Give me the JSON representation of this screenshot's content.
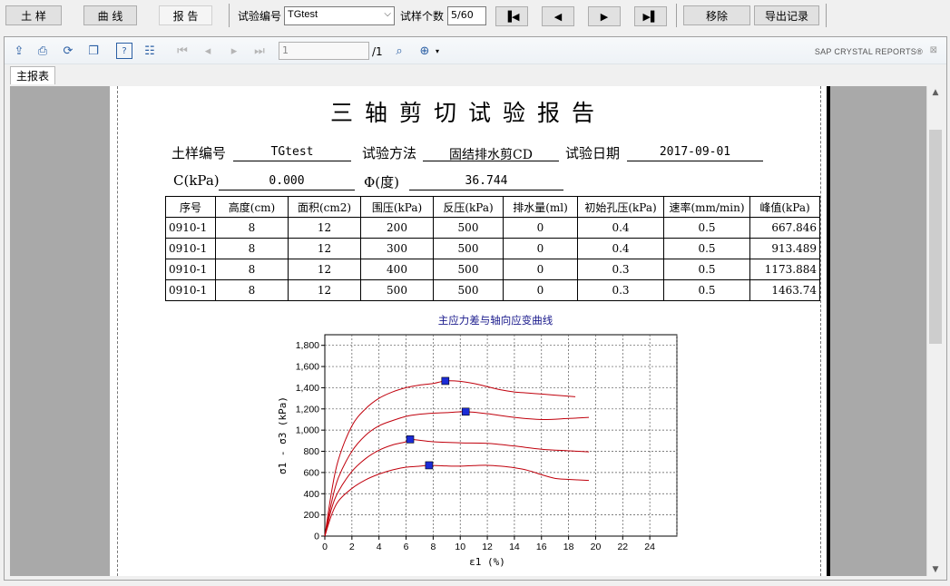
{
  "topbar": {
    "btn_soil": "土 样",
    "btn_curve": "曲 线",
    "btn_report": "报 告",
    "test_no_label": "试验编号",
    "test_no_value": "TGtest",
    "sample_count_label": "试样个数",
    "sample_count_value": "5/60",
    "nav_first": "▐◀",
    "nav_prev": "◀",
    "nav_next": "▶",
    "nav_last": "▶▌",
    "btn_remove": "移除",
    "btn_export": "导出记录"
  },
  "viewer": {
    "page_value": "1",
    "page_total": "/1",
    "brand": "SAP CRYSTAL REPORTS®",
    "tab_main": "主报表"
  },
  "report": {
    "title": "三轴剪切试验报告",
    "soil_no_label": "土样编号",
    "soil_no_value": "TGtest",
    "method_label": "试验方法",
    "method_value": "固结排水剪CD",
    "date_label": "试验日期",
    "date_value": "2017-09-01",
    "c_label": "C(kPa)",
    "c_value": "0.000",
    "phi_label": "Φ(度)",
    "phi_value": "36.744",
    "table_headers": [
      "序号",
      "高度(cm)",
      "面积(cm2)",
      "围压(kPa)",
      "反压(kPa)",
      "排水量(ml)",
      "初始孔压(kPa)",
      "速率(mm/min)",
      "峰值(kPa)"
    ],
    "table_rows": [
      [
        "0910-1",
        "8",
        "12",
        "200",
        "500",
        "0",
        "0.4",
        "0.5",
        "667.846"
      ],
      [
        "0910-1",
        "8",
        "12",
        "300",
        "500",
        "0",
        "0.4",
        "0.5",
        "913.489"
      ],
      [
        "0910-1",
        "8",
        "12",
        "400",
        "500",
        "0",
        "0.3",
        "0.5",
        "1173.884"
      ],
      [
        "0910-1",
        "8",
        "12",
        "500",
        "500",
        "0",
        "0.3",
        "0.5",
        "1463.74"
      ]
    ]
  },
  "colors": {
    "curve": "#c0000c",
    "marker": "#1b2bd6",
    "chart_title": "#1a1a8c",
    "accent": "#2b5fa4"
  },
  "chart_data": {
    "type": "line",
    "title": "主应力差与轴向应变曲线",
    "xlabel": "ε1 (%)",
    "ylabel": "σ1 - σ3 (kPa)",
    "xlim": [
      0,
      26
    ],
    "ylim": [
      0,
      1900
    ],
    "xticks": [
      "0",
      "2",
      "4",
      "6",
      "8",
      "10",
      "12",
      "14",
      "16",
      "18",
      "20",
      "22",
      "24"
    ],
    "yticks": [
      "0",
      "200",
      "400",
      "600",
      "800",
      "1,000",
      "1,200",
      "1,400",
      "1,600",
      "1,800"
    ],
    "grid": true,
    "series": [
      {
        "x": [
          0,
          0.5,
          1,
          2,
          3,
          4,
          5,
          6,
          7,
          7.7,
          9,
          10,
          11,
          12,
          13,
          14,
          15,
          16,
          17,
          18,
          19.5
        ],
        "values": [
          0,
          200,
          330,
          450,
          530,
          585,
          625,
          650,
          660,
          668,
          662,
          660,
          665,
          668,
          660,
          645,
          620,
          580,
          545,
          535,
          525
        ],
        "peak": [
          7.7,
          668
        ]
      },
      {
        "x": [
          0,
          0.5,
          1,
          2,
          3,
          4,
          5,
          6,
          6.3,
          8,
          10,
          12,
          14,
          16,
          18,
          19.5
        ],
        "values": [
          0,
          260,
          420,
          610,
          730,
          810,
          860,
          890,
          913,
          890,
          880,
          875,
          850,
          820,
          805,
          795
        ],
        "peak": [
          6.3,
          913
        ]
      },
      {
        "x": [
          0,
          0.5,
          1,
          2,
          3,
          4,
          5,
          6,
          7,
          8,
          9,
          10.4,
          12,
          14,
          16,
          18,
          19.5
        ],
        "values": [
          0,
          320,
          550,
          800,
          950,
          1040,
          1090,
          1130,
          1150,
          1160,
          1165,
          1174,
          1155,
          1120,
          1100,
          1110,
          1120
        ],
        "peak": [
          10.4,
          1174
        ]
      },
      {
        "x": [
          0,
          0.5,
          1,
          2,
          3,
          4,
          5,
          6,
          7,
          8,
          8.9,
          10,
          11,
          12,
          13,
          14,
          15,
          16,
          17,
          18.5
        ],
        "values": [
          0,
          420,
          720,
          1040,
          1200,
          1300,
          1360,
          1400,
          1425,
          1440,
          1464,
          1460,
          1440,
          1410,
          1380,
          1360,
          1350,
          1340,
          1330,
          1315
        ],
        "peak": [
          8.9,
          1464
        ]
      }
    ]
  }
}
